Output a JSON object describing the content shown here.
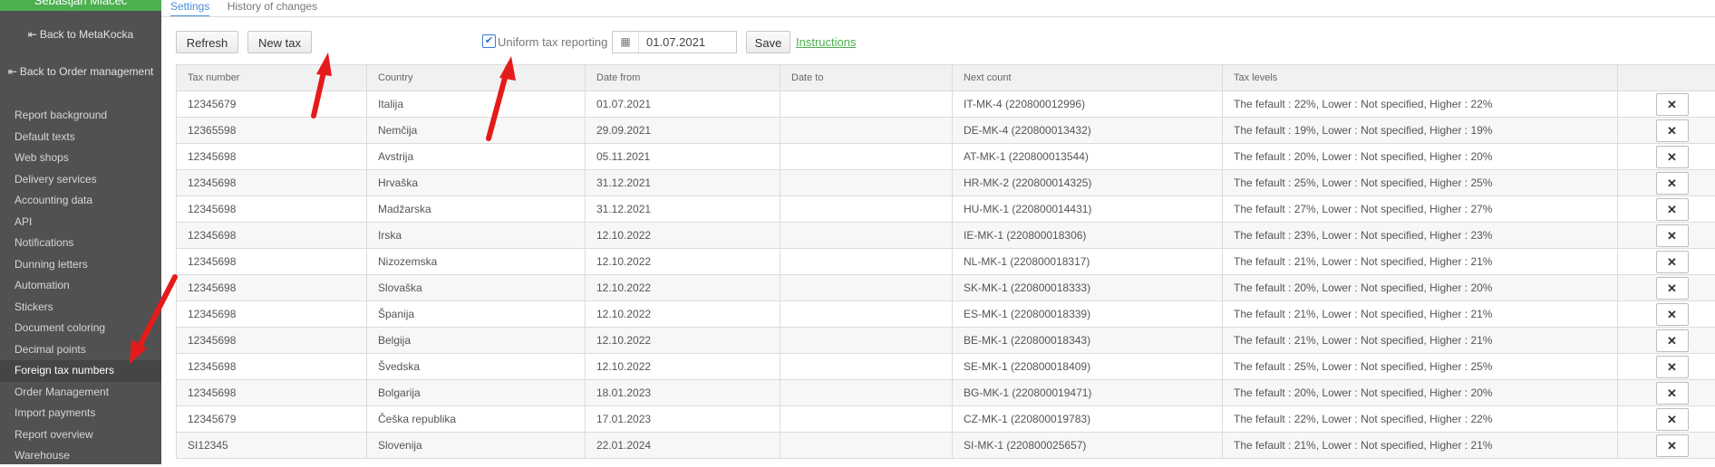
{
  "sidebar": {
    "user": "Sebastjan Mlačec",
    "back_links": [
      {
        "icon": "exit-icon",
        "label": "Back to MetaKocka"
      },
      {
        "icon": "exit-icon",
        "label": "Back to Order management"
      }
    ],
    "items": [
      {
        "label": "Report background"
      },
      {
        "label": "Default texts"
      },
      {
        "label": "Web shops"
      },
      {
        "label": "Delivery services"
      },
      {
        "label": "Accounting data"
      },
      {
        "label": "API"
      },
      {
        "label": "Notifications"
      },
      {
        "label": "Dunning letters"
      },
      {
        "label": "Automation"
      },
      {
        "label": "Stickers"
      },
      {
        "label": "Document coloring"
      },
      {
        "label": "Decimal points"
      },
      {
        "label": "Foreign tax numbers",
        "active": true
      },
      {
        "label": "Order Management"
      },
      {
        "label": "Import payments"
      },
      {
        "label": "Report overview"
      },
      {
        "label": "Warehouse"
      }
    ]
  },
  "tabs": [
    {
      "label": "Settings",
      "active": true
    },
    {
      "label": "History of changes",
      "active": false
    }
  ],
  "toolbar": {
    "refresh_label": "Refresh",
    "new_tax_label": "New tax",
    "uniform_label": "Uniform tax reporting",
    "uniform_checked": true,
    "date_value": "01.07.2021",
    "save_label": "Save",
    "instructions_label": "Instructions"
  },
  "table": {
    "headers": [
      "Tax number",
      "Country",
      "Date from",
      "Date to",
      "Next count",
      "Tax levels",
      ""
    ],
    "delete_label": "✕",
    "rows": [
      [
        "12345679",
        "Italija",
        "01.07.2021",
        "",
        "IT-MK-4 (220800012996)",
        "The fefault : 22%, Lower : Not specified, Higher : 22%"
      ],
      [
        "12365598",
        "Nemčija",
        "29.09.2021",
        "",
        "DE-MK-4 (220800013432)",
        "The fefault : 19%, Lower : Not specified, Higher : 19%"
      ],
      [
        "12345698",
        "Avstrija",
        "05.11.2021",
        "",
        "AT-MK-1 (220800013544)",
        "The fefault : 20%, Lower : Not specified, Higher : 20%"
      ],
      [
        "12345698",
        "Hrvaška",
        "31.12.2021",
        "",
        "HR-MK-2 (220800014325)",
        "The fefault : 25%, Lower : Not specified, Higher : 25%"
      ],
      [
        "12345698",
        "Madžarska",
        "31.12.2021",
        "",
        "HU-MK-1 (220800014431)",
        "The fefault : 27%, Lower : Not specified, Higher : 27%"
      ],
      [
        "12345698",
        "Irska",
        "12.10.2022",
        "",
        "IE-MK-1 (220800018306)",
        "The fefault : 23%, Lower : Not specified, Higher : 23%"
      ],
      [
        "12345698",
        "Nizozemska",
        "12.10.2022",
        "",
        "NL-MK-1 (220800018317)",
        "The fefault : 21%, Lower : Not specified, Higher : 21%"
      ],
      [
        "12345698",
        "Slovaška",
        "12.10.2022",
        "",
        "SK-MK-1 (220800018333)",
        "The fefault : 20%, Lower : Not specified, Higher : 20%"
      ],
      [
        "12345698",
        "Španija",
        "12.10.2022",
        "",
        "ES-MK-1 (220800018339)",
        "The fefault : 21%, Lower : Not specified, Higher : 21%"
      ],
      [
        "12345698",
        "Belgija",
        "12.10.2022",
        "",
        "BE-MK-1 (220800018343)",
        "The fefault : 21%, Lower : Not specified, Higher : 21%"
      ],
      [
        "12345698",
        "Švedska",
        "12.10.2022",
        "",
        "SE-MK-1 (220800018409)",
        "The fefault : 25%, Lower : Not specified, Higher : 25%"
      ],
      [
        "12345698",
        "Bolgarija",
        "18.01.2023",
        "",
        "BG-MK-1 (220800019471)",
        "The fefault : 20%, Lower : Not specified, Higher : 20%"
      ],
      [
        "12345679",
        "Češka republika",
        "17.01.2023",
        "",
        "CZ-MK-1 (220800019783)",
        "The fefault : 22%, Lower : Not specified, Higher : 22%"
      ],
      [
        "SI12345",
        "Slovenija",
        "22.01.2024",
        "",
        "SI-MK-1 (220800025657)",
        "The fefault : 21%, Lower : Not specified, Higher : 21%"
      ]
    ]
  },
  "colors": {
    "sidebar_bg": "#515151",
    "user_bar": "#4caf50",
    "tab_active": "#4a90d9",
    "link": "#4caf50",
    "annotation_arrow": "#e51b1b"
  }
}
